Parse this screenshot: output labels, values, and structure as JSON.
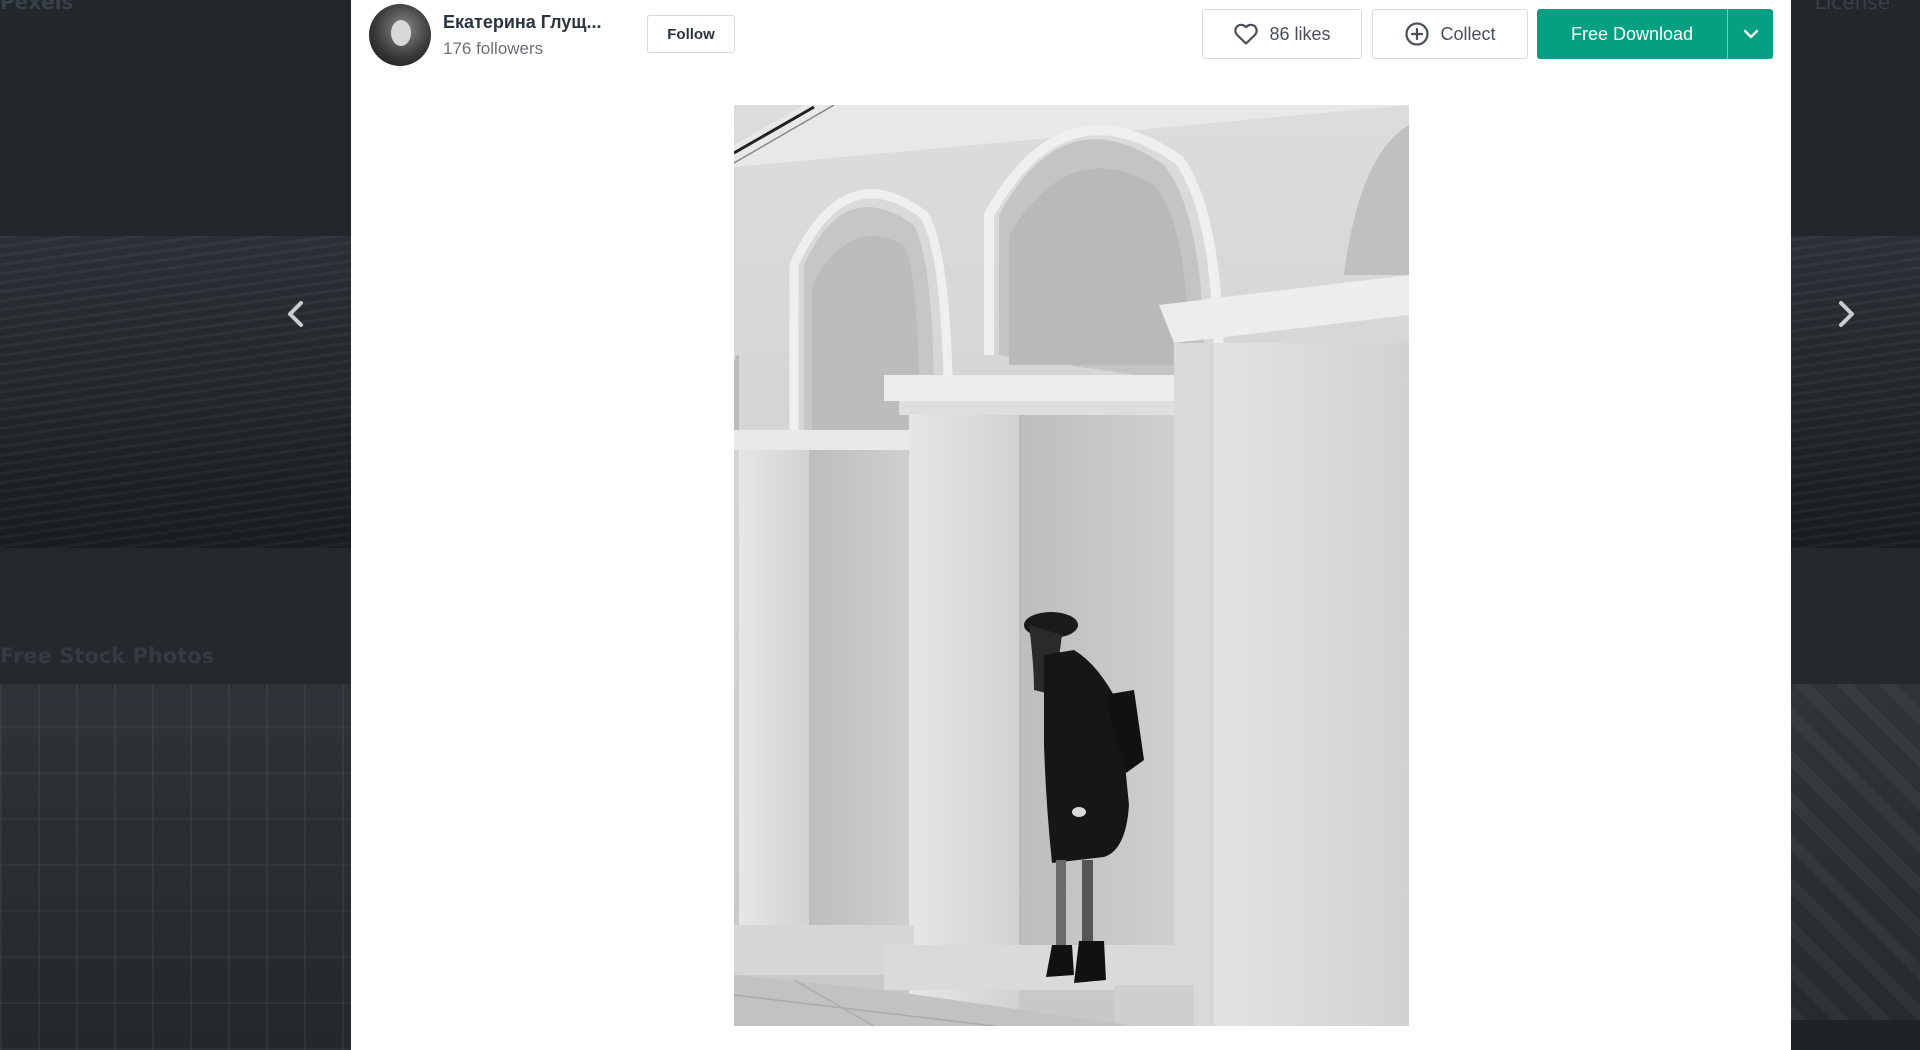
{
  "background": {
    "brand": "Pexels",
    "license_link": "License",
    "section_title": "Free Stock Photos"
  },
  "photographer": {
    "name": "Екатерина Глущ...",
    "followers": "176 followers",
    "follow_label": "Follow"
  },
  "actions": {
    "likes_label": "86 likes",
    "collect_label": "Collect",
    "download_label": "Free Download"
  },
  "icons": {
    "prev": "chevron-left-icon",
    "next": "chevron-right-icon",
    "like": "heart-icon",
    "collect": "plus-circle-icon",
    "dropdown": "chevron-down-icon"
  },
  "colors": {
    "accent": "#05a081",
    "overlay": "#1f2327",
    "modal_bg": "#ffffff"
  }
}
